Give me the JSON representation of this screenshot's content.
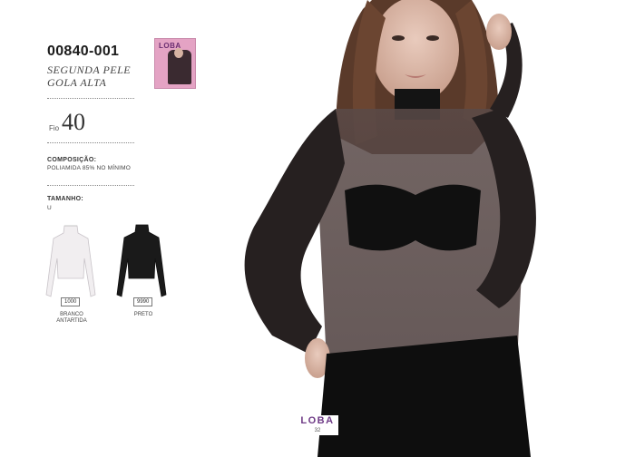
{
  "product": {
    "code": "00840-001",
    "name_line1": "SEGUNDA PELE",
    "name_line2": "GOLA ALTA",
    "fio_label": "Fio",
    "fio_value": "40"
  },
  "composition": {
    "title": "COMPOSIÇÃO:",
    "value": "POLIAMIDA 85% NO MÍNIMO"
  },
  "size": {
    "title": "TAMANHO:",
    "value": "U"
  },
  "package": {
    "logo_text": "LOBA"
  },
  "swatches": [
    {
      "code": "1000",
      "name_line1": "BRANCO",
      "name_line2": "ANTARTIDA",
      "color": "#f1eef0"
    },
    {
      "code": "9990",
      "name_line1": "PRETO",
      "name_line2": "",
      "color": "#1a1a1a"
    }
  ],
  "footer": {
    "brand": "LOBA",
    "page_number": "32"
  },
  "colors": {
    "brand_purple": "#6e3a86",
    "package_pink": "#e4a3c4"
  }
}
